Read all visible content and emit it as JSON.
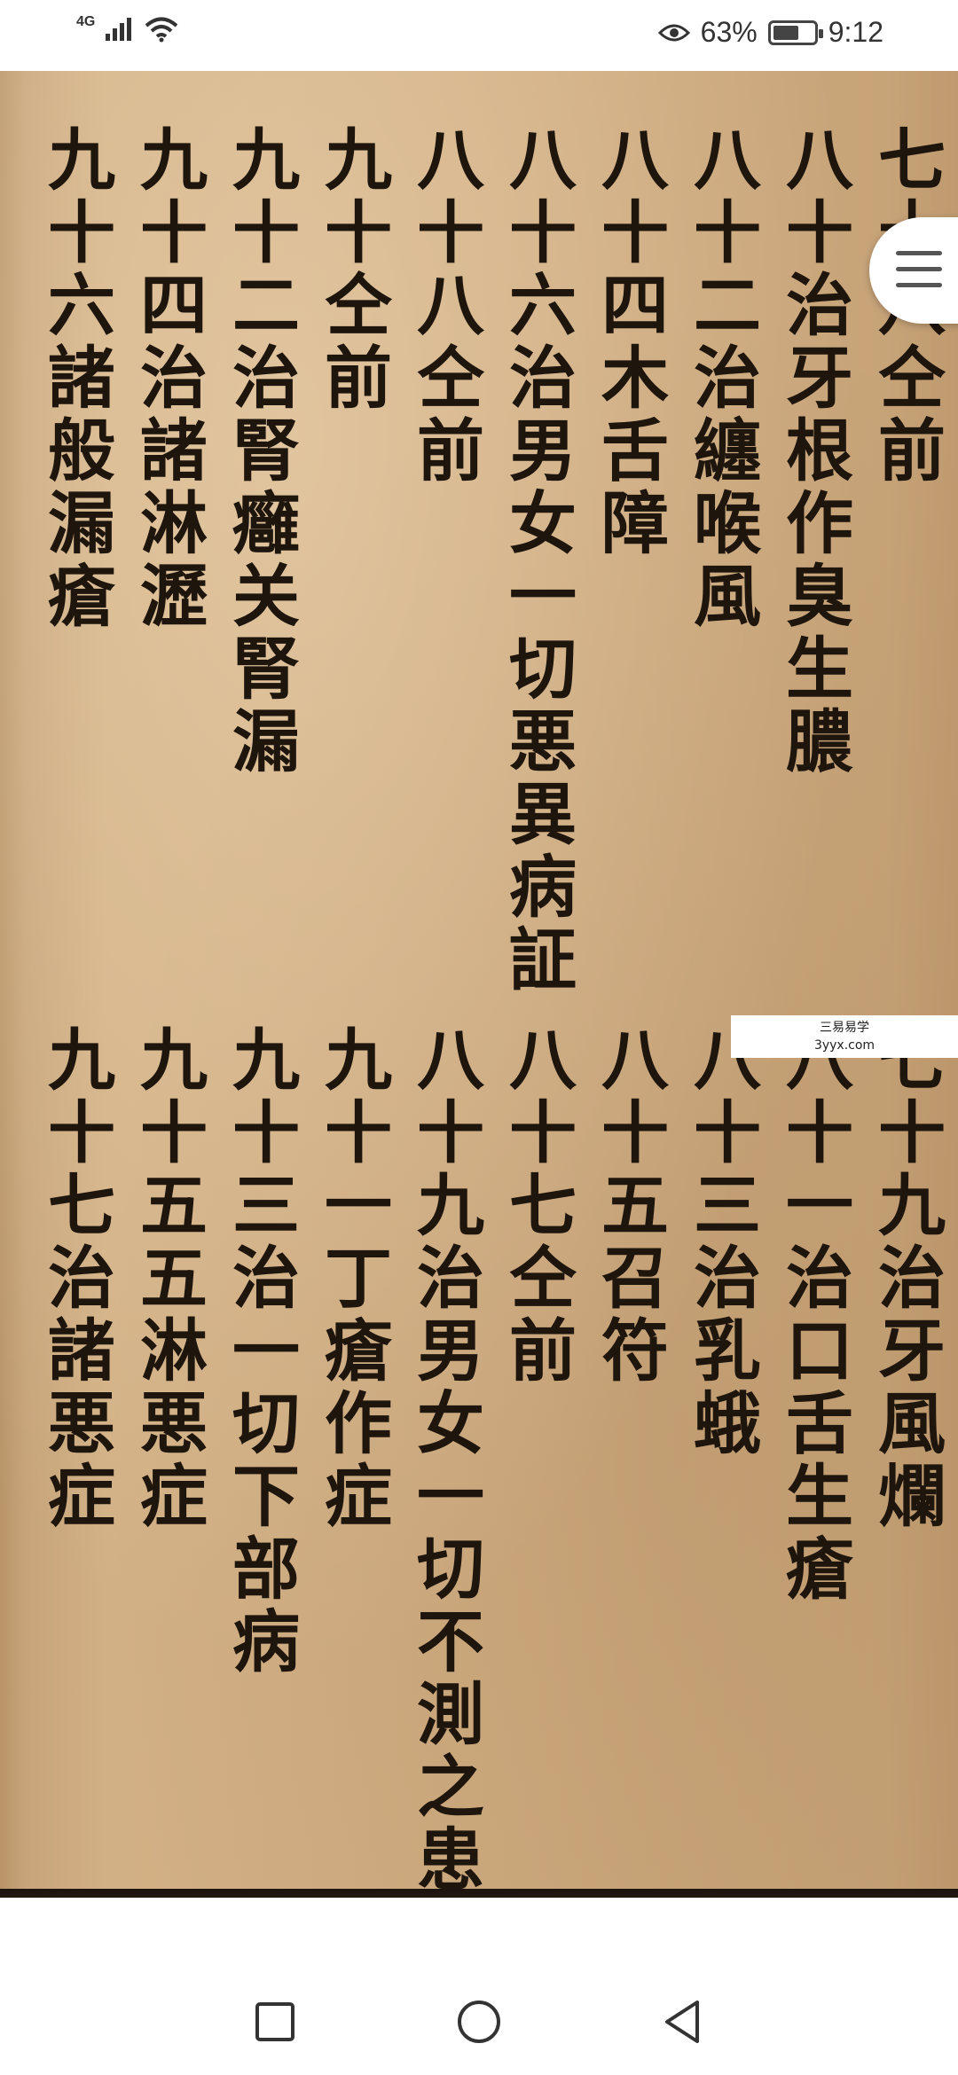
{
  "status_bar": {
    "network": "4G",
    "battery_percent": "63%",
    "battery_level": 0.63,
    "time": "9:12"
  },
  "document": {
    "top_columns": [
      "七十八仝前",
      "八十治牙根作臭生膿",
      "八十二治纏喉風",
      "八十四木舌障",
      "八十六治男女一切悪異病証",
      "八十八仝前",
      "九十仝前",
      "九十二治腎癰关腎漏",
      "九十四治諸淋瀝",
      "九十六諸般漏瘡"
    ],
    "bottom_columns": [
      "七十九治牙風爛",
      "八十一治口舌生瘡",
      "八十三治乳蛾",
      "八十五召符",
      "八十七仝前",
      "八十九治男女一切不測之患",
      "九十一丁瘡作症",
      "九十三治一切下部病",
      "九十五五淋悪症",
      "九十七治諸悪症"
    ]
  },
  "watermark": {
    "line1": "三易易学",
    "line2": "3yyx.com"
  }
}
